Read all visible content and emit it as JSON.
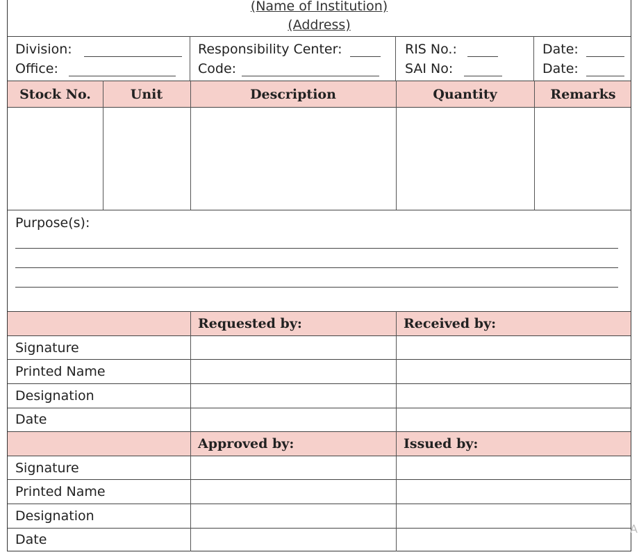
{
  "header": {
    "institution": "(Name of Institution)",
    "address": "(Address)"
  },
  "info": {
    "division": "Division:",
    "office": "Office:",
    "responsibility_center": "Responsibility Center:",
    "code": "Code:",
    "ris_no": "RIS No.:",
    "sai_no": "SAI No:",
    "date1": "Date:",
    "date2": "Date:"
  },
  "table": {
    "columns": [
      "Stock No.",
      "Unit",
      "Description",
      "Quantity",
      "Remarks"
    ]
  },
  "purpose": {
    "label": "Purpose(s):"
  },
  "signatories": {
    "section1": {
      "left": "Requested by:",
      "right": "Received by:"
    },
    "section2": {
      "left": "Approved by:",
      "right": "Issued by:"
    },
    "rows": [
      "Signature",
      "Printed Name",
      "Designation",
      "Date"
    ]
  },
  "corner_glyph": "A"
}
